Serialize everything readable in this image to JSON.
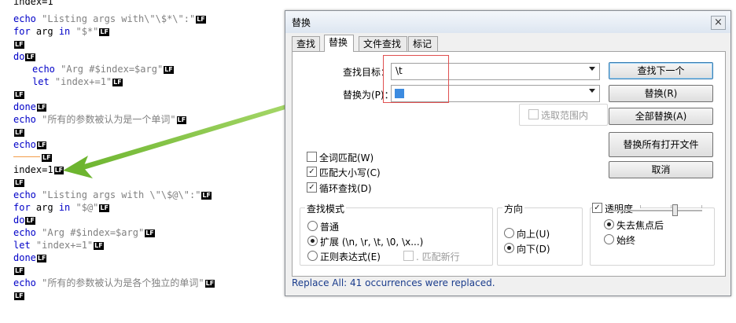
{
  "editor": {
    "lines": [
      {
        "t": "partial",
        "text": "index=1"
      },
      {
        "t": "echo_listing1",
        "kw": "echo",
        "str": " \"Listing args with\\\"\\$*\\\":\""
      },
      {
        "t": "for1",
        "kw1": "for",
        "plain": " arg ",
        "kw2": "in",
        "str": " \"$*\""
      },
      {
        "t": "plain",
        "text": ""
      },
      {
        "t": "kwonly",
        "kw": "do"
      },
      {
        "t": "indent_echo",
        "kw": "echo",
        "str": " \"Arg #$index=$arg\""
      },
      {
        "t": "indent_let",
        "kw": "let",
        "str": " \"index+=1\""
      },
      {
        "t": "plain",
        "text": ""
      },
      {
        "t": "kwonly",
        "kw": "done"
      },
      {
        "t": "echo_cn1",
        "kw": "echo",
        "str": " \"所有的参数被认为是一个单词\""
      },
      {
        "t": "plain",
        "text": ""
      },
      {
        "t": "kwonly",
        "kw": "echo"
      },
      {
        "t": "tab",
        "text": ""
      },
      {
        "t": "plainline",
        "text": "index=1"
      },
      {
        "t": "plain",
        "text": ""
      },
      {
        "t": "echo_listing2",
        "kw": "echo",
        "str": " \"Listing args with \\\"\\$@\\\":\""
      },
      {
        "t": "for2",
        "kw1": "for",
        "plain": " arg ",
        "kw2": "in",
        "str": " \"$@\""
      },
      {
        "t": "kwonly",
        "kw": "do"
      },
      {
        "t": "echo_arg",
        "kw": "echo",
        "str": " \"Arg #$index=$arg\""
      },
      {
        "t": "let",
        "kw": "let",
        "str": " \"index+=1\""
      },
      {
        "t": "kwonly",
        "kw": "done"
      },
      {
        "t": "plain",
        "text": ""
      },
      {
        "t": "echo_cn2",
        "kw": "echo",
        "str": " \"所有的参数被认为是各个独立的单词\""
      },
      {
        "t": "plain",
        "text": ""
      }
    ],
    "eol_marker": "LF"
  },
  "dialog": {
    "title": "替换",
    "close_glyph": "×",
    "tabs": [
      "查找",
      "替换",
      "文件查找",
      "标记"
    ],
    "active_tab": 1,
    "find_label": "查找目标：",
    "find_value": "\\t",
    "replace_label": "替换为(P)：",
    "replace_value": "",
    "in_selection_label": "选取范围内",
    "buttons": {
      "find_next": "查找下一个",
      "replace": "替换(R)",
      "replace_all": "全部替换(A)",
      "replace_all_open": "替换所有打开文件",
      "cancel": "取消"
    },
    "options": {
      "whole_word": {
        "label": "全词匹配(W)",
        "checked": false
      },
      "match_case": {
        "label": "匹配大小写(C)",
        "checked": true
      },
      "wrap_around": {
        "label": "循环查找(D)",
        "checked": true
      }
    },
    "search_mode": {
      "title": "查找模式",
      "normal": "普通",
      "extended": "扩展 (\\n, \\r, \\t, \\0, \\x...)",
      "regex": "正则表达式(E)",
      "dot_newline": ". 匹配新行",
      "selected": "extended"
    },
    "direction": {
      "title": "方向",
      "up": "向上(U)",
      "down": "向下(D)",
      "selected": "down"
    },
    "transparency": {
      "label": "透明度",
      "checked": true,
      "on_lose_focus": "失去焦点后",
      "always": "始终",
      "selected": "on_lose_focus"
    },
    "status": "Replace All: 41 occurrences were replaced."
  },
  "colors": {
    "keyword": "#0000c8",
    "string": "#808080",
    "arrow": "#8cc63e",
    "highlight_box": "#e05050",
    "status_text": "#1a3c8c"
  }
}
